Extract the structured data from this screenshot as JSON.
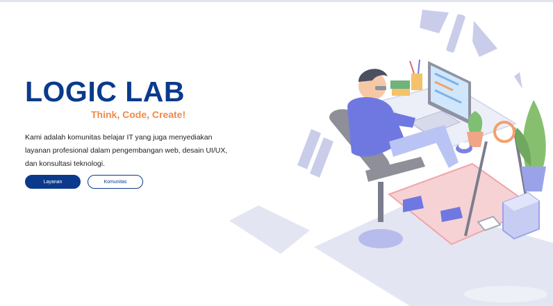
{
  "hero": {
    "title": "LOGIC LAB",
    "tagline": "Think, Code, Create!",
    "description": "Kami adalah komunitas belajar IT yang juga menyediakan layanan profesional dalam pengembangan web, desain UI/UX, dan konsultasi teknologi.",
    "buttons": {
      "primary_label": "Layanan",
      "secondary_label": "Komunitas"
    }
  },
  "colors": {
    "brand": "#0b3a8c",
    "accent": "#f08a4b",
    "illustration_base": "#dfe3f3",
    "illustration_purple": "#7b82e0"
  },
  "illustration": {
    "subject": "person-coding-at-desk-illustration"
  }
}
